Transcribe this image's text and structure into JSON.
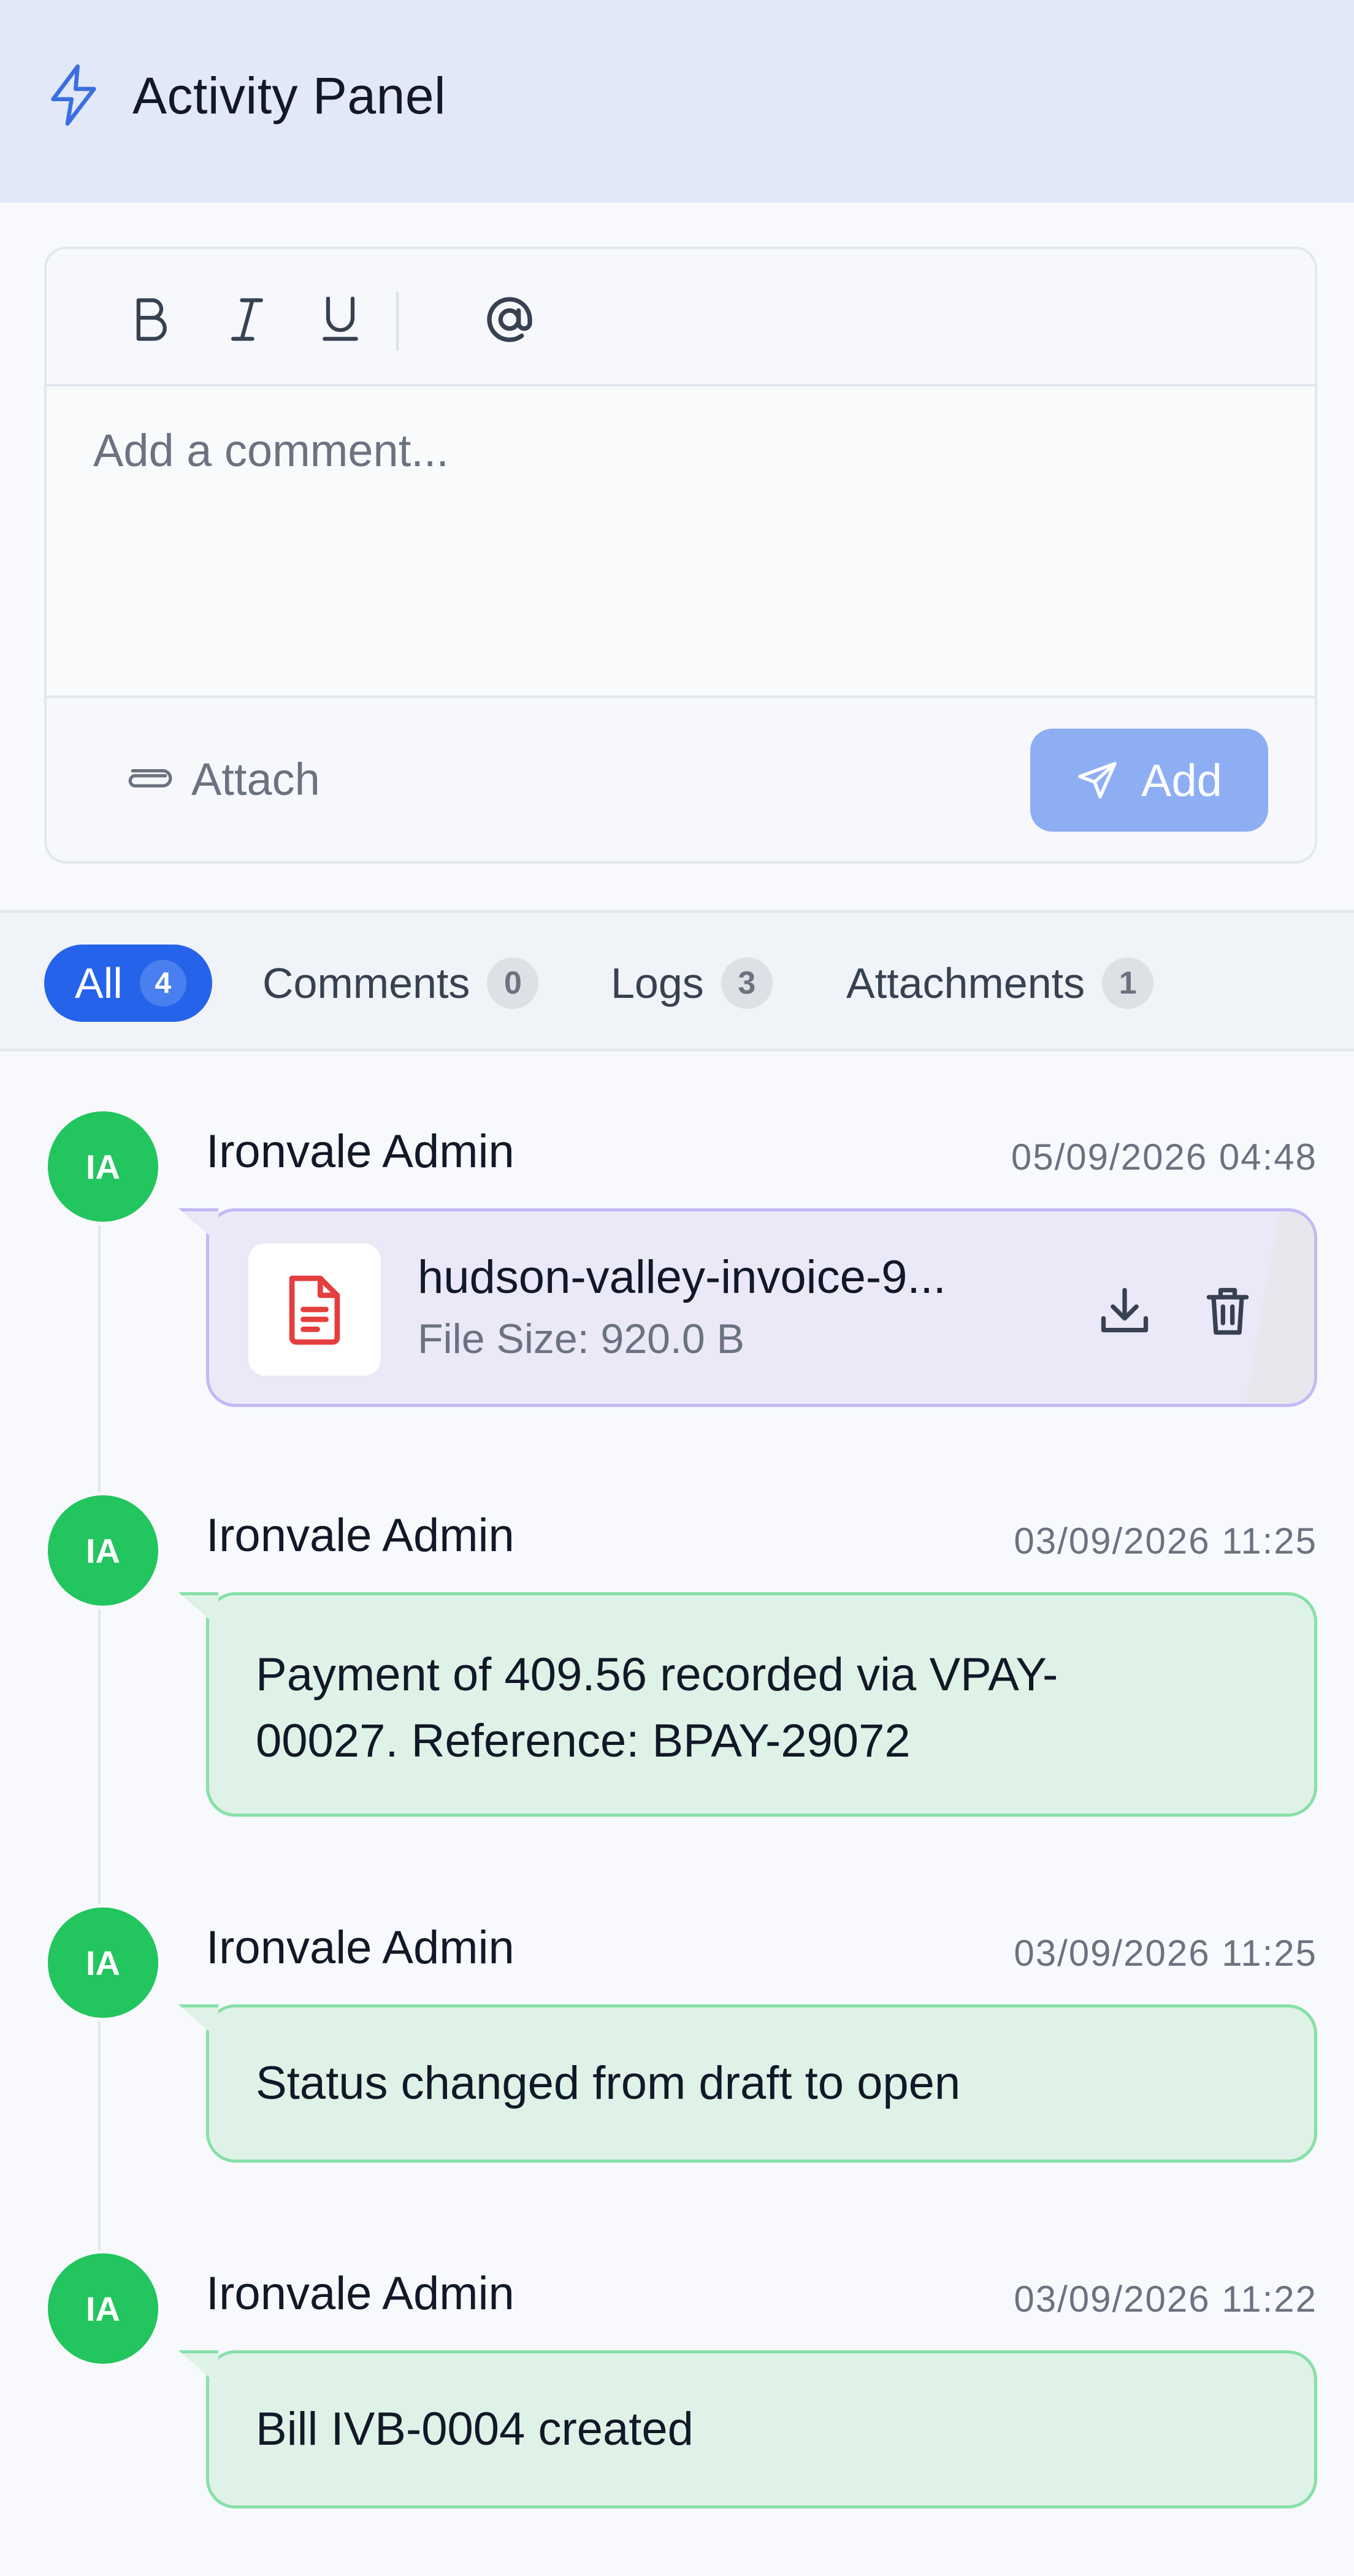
{
  "header": {
    "title": "Activity Panel",
    "icon": "bolt-icon"
  },
  "editor": {
    "placeholder": "Add a comment...",
    "attach_label": "Attach",
    "add_label": "Add",
    "toolbar": [
      "bold-icon",
      "italic-icon",
      "underline-icon",
      "at-mention-icon"
    ]
  },
  "tabs": [
    {
      "label": "All",
      "count": "4",
      "active": true
    },
    {
      "label": "Comments",
      "count": "0"
    },
    {
      "label": "Logs",
      "count": "3"
    },
    {
      "label": "Attachments",
      "count": "1"
    }
  ],
  "entries": [
    {
      "initials": "IA",
      "author": "Ironvale Admin",
      "time": "05/09/2026 04:48",
      "type": "attachment",
      "file_name": "hudson-valley-invoice-9...",
      "file_size": "File Size: 920.0 B"
    },
    {
      "initials": "IA",
      "author": "Ironvale Admin",
      "time": "03/09/2026 11:25",
      "type": "log",
      "text_line1": "Payment of 409.56 recorded via VPAY-",
      "text_line2": "00027. Reference: BPAY-29072"
    },
    {
      "initials": "IA",
      "author": "Ironvale Admin",
      "time": "03/09/2026 11:25",
      "type": "log",
      "text": "Status changed from draft to open"
    },
    {
      "initials": "IA",
      "author": "Ironvale Admin",
      "time": "03/09/2026 11:22",
      "type": "log",
      "text": "Bill IVB-0004 created"
    }
  ],
  "colors": {
    "accent": "#2563eb",
    "avatar": "#22c55e",
    "log_bubble": "#dff2e7",
    "attachment_bubble": "#ebe8f7",
    "pdf_icon": "#e53e3e"
  }
}
